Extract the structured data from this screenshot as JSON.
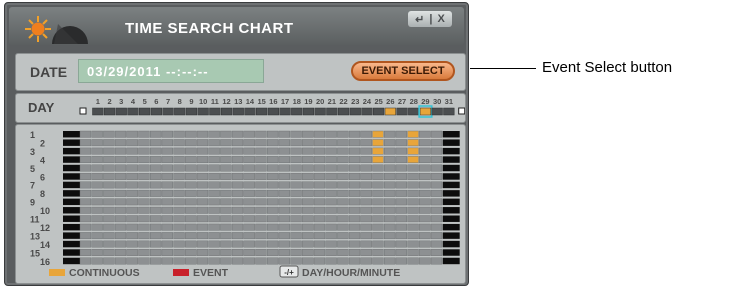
{
  "window": {
    "title": "TIME SEARCH CHART",
    "controls": [
      "↵",
      "|",
      "X"
    ]
  },
  "date_row": {
    "label": "DATE",
    "value": "03/29/2011 --:--:--",
    "event_select_label": "EVENT SELECT"
  },
  "day_row": {
    "label": "DAY",
    "days": [
      "1",
      "2",
      "3",
      "4",
      "5",
      "6",
      "7",
      "8",
      "9",
      "10",
      "11",
      "12",
      "13",
      "14",
      "15",
      "16",
      "17",
      "18",
      "19",
      "20",
      "21",
      "22",
      "23",
      "24",
      "25",
      "26",
      "27",
      "28",
      "29",
      "30",
      "31"
    ],
    "recorded_days": [
      26,
      29
    ],
    "selected_day": 29
  },
  "chart": {
    "channels": [
      "1",
      "2",
      "3",
      "4",
      "5",
      "6",
      "7",
      "8",
      "9",
      "10",
      "11",
      "12",
      "13",
      "14",
      "15",
      "16"
    ],
    "continuous_recordings": [
      {
        "channel": 1,
        "days": [
          26,
          29
        ]
      },
      {
        "channel": 2,
        "days": [
          26,
          29
        ]
      },
      {
        "channel": 3,
        "days": [
          26,
          29
        ]
      },
      {
        "channel": 4,
        "days": [
          26,
          29
        ]
      }
    ]
  },
  "legend": {
    "continuous": "CONTINUOUS",
    "event": "EVENT",
    "zoom_key": "-/+",
    "zoom_label": "DAY/HOUR/MINUTE"
  },
  "callout": {
    "text": "Event Select button"
  },
  "colors": {
    "continuous": "#e8a53a",
    "event": "#c8202a",
    "selected_day_outline": "#35c4d6",
    "track_empty": "#8d9092",
    "track_black": "#0d0d0d"
  }
}
